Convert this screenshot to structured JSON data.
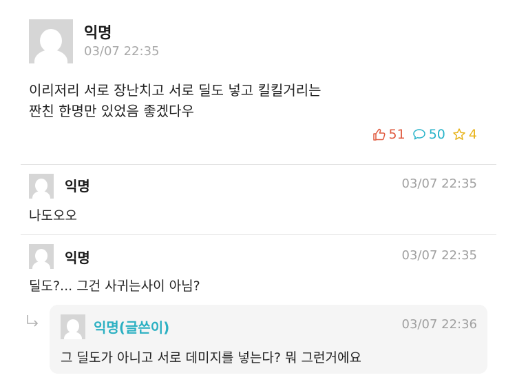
{
  "post": {
    "author": "익명",
    "time": "03/07 22:35",
    "body_lines": [
      "이리저리 서로 장난치고 서로 딜도 넣고 킬킬거리는",
      "짠친 한명만 있었음 좋겠다우"
    ],
    "likes": "51",
    "comments": "50",
    "scraps": "4"
  },
  "comments": [
    {
      "author": "익명",
      "time": "03/07 22:35",
      "text": "나도오오"
    },
    {
      "author": "익명",
      "time": "03/07 22:35",
      "text": "딜도?... 그건 사귀는사이 아님?"
    }
  ],
  "reply": {
    "author": "익명(글쓴이)",
    "time": "03/07 22:36",
    "text": "그 딜도가 아니고 서로 데미지를 넣는다? 뭐 그런거에요"
  },
  "colors": {
    "like": "#e05a3f",
    "comment": "#27b3c9",
    "scrap": "#e8b31a",
    "writer": "#2bb0c2"
  }
}
